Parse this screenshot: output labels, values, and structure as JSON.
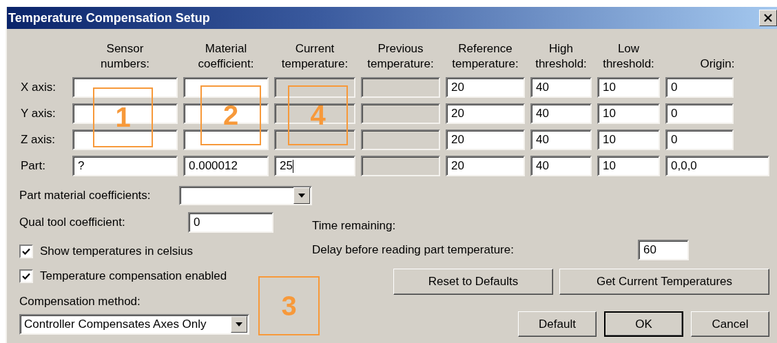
{
  "window": {
    "title": "Temperature Compensation Setup"
  },
  "columns": [
    "Sensor\nnumbers:",
    "Material\ncoefficient:",
    "Current\ntemperature:",
    "Previous\ntemperature:",
    "Reference\ntemperature:",
    "High\nthreshold:",
    "Low\nthreshold:",
    "Origin:"
  ],
  "rows": [
    {
      "label": "X axis:",
      "cells": [
        {
          "disabled": false
        },
        {
          "disabled": false
        },
        {
          "disabled": true
        },
        {
          "disabled": true
        },
        {
          "value": "20",
          "disabled": false
        },
        {
          "value": "40",
          "disabled": false
        },
        {
          "value": "10",
          "disabled": false
        },
        {
          "value": "0",
          "disabled": false
        }
      ]
    },
    {
      "label": "Y axis:",
      "cells": [
        {
          "disabled": false
        },
        {
          "disabled": false
        },
        {
          "disabled": true
        },
        {
          "disabled": true
        },
        {
          "value": "20",
          "disabled": false
        },
        {
          "value": "40",
          "disabled": false
        },
        {
          "value": "10",
          "disabled": false
        },
        {
          "value": "0",
          "disabled": false
        }
      ]
    },
    {
      "label": "Z axis:",
      "cells": [
        {
          "disabled": false
        },
        {
          "disabled": false
        },
        {
          "disabled": true
        },
        {
          "disabled": true
        },
        {
          "value": "20",
          "disabled": false
        },
        {
          "value": "40",
          "disabled": false
        },
        {
          "value": "10",
          "disabled": false
        },
        {
          "value": "0",
          "disabled": false
        }
      ]
    },
    {
      "label": "Part:",
      "cells": [
        {
          "value": "?",
          "disabled": false
        },
        {
          "value": "0.000012",
          "disabled": false
        },
        {
          "value": "25",
          "disabled": false,
          "focused": true
        },
        {
          "disabled": true
        },
        {
          "value": "20",
          "disabled": false
        },
        {
          "value": "40",
          "disabled": false
        },
        {
          "value": "10",
          "disabled": false
        },
        {
          "value": "0,0,0",
          "disabled": false
        }
      ]
    }
  ],
  "part_material_coefficients": {
    "label": "Part material coefficients:"
  },
  "qual_tool_coefficient": {
    "label": "Qual tool coefficient:",
    "value": "0"
  },
  "checkboxes": [
    {
      "label": "Show temperatures in celsius",
      "checked": true
    },
    {
      "label": "Temperature compensation enabled",
      "checked": true
    }
  ],
  "compensation_method": {
    "label": "Compensation method:",
    "value": "Controller Compensates Axes Only"
  },
  "time_remaining": {
    "label": "Time remaining:"
  },
  "delay": {
    "label": "Delay before reading part temperature:",
    "value": "60"
  },
  "action_buttons": [
    {
      "label": "Reset to Defaults"
    },
    {
      "label": "Get Current Temperatures"
    }
  ],
  "dialog_buttons": [
    {
      "label": "Default",
      "default": false
    },
    {
      "label": "OK",
      "default": true
    },
    {
      "label": "Cancel",
      "default": false
    }
  ],
  "callouts": [
    {
      "label": "1"
    },
    {
      "label": "2"
    },
    {
      "label": "4"
    },
    {
      "label": "3"
    }
  ]
}
